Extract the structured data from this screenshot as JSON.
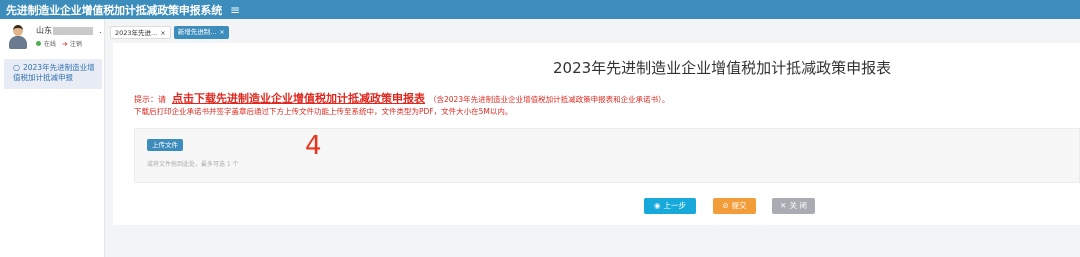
{
  "header": {
    "title": "先进制造业企业增值税加计抵减政策申报系统",
    "menu_icon": "hamburger-menu-icon",
    "background": "#3c8dbc"
  },
  "user": {
    "name_prefix": "山东",
    "name_suffix": ".",
    "status_label": "在线",
    "logout_label": "注销"
  },
  "sidebar": {
    "items": [
      {
        "label": "2023年先进制造业增值税加计抵减申报",
        "icon": "circle-icon"
      }
    ]
  },
  "tabs": [
    {
      "label": "2023年先进...",
      "close": "×",
      "active": false
    },
    {
      "label": "新增先进制...",
      "close": "×",
      "active": true
    }
  ],
  "form": {
    "title": "2023年先进制造业企业增值税加计抵减政策申报表",
    "tip_prefix": "提示：请",
    "tip_link": "点击下载先进制造业企业增值税加计抵减政策申报表",
    "tip_paren": "（含2023年先进制造业企业增值税加计抵减政策申报表和企业承诺书）。",
    "note": "下载后打印企业承诺书并签字盖章后通过下方上传文件功能上传至系统中，文件类型为PDF，文件大小在5M以内。",
    "upload_button": "上传文件",
    "upload_hint": "或将文件拖到此处，最多可选 1 个",
    "annotation_number": "4"
  },
  "actions": {
    "prev": "上一步",
    "submit": "提交",
    "close": "关 闭"
  },
  "colors": {
    "primary": "#3c8dbc",
    "alert": "#e0281f",
    "prev": "#16a9d9",
    "submit": "#f39c3a",
    "close": "#a9adb3"
  }
}
